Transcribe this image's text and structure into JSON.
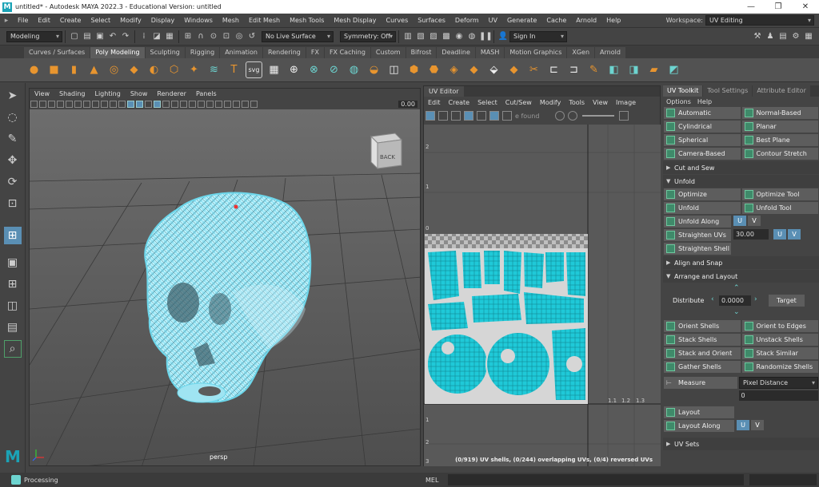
{
  "window": {
    "title": "untitled* - Autodesk MAYA 2022.3 - Educational Version: untitled",
    "minimize": "—",
    "maximize": "❐",
    "close": "✕"
  },
  "menu": [
    "File",
    "Edit",
    "Create",
    "Select",
    "Modify",
    "Display",
    "Windows",
    "Mesh",
    "Edit Mesh",
    "Mesh Tools",
    "Mesh Display",
    "Curves",
    "Surfaces",
    "Deform",
    "UV",
    "Generate",
    "Cache",
    "Arnold",
    "Help"
  ],
  "workspace": {
    "label": "Workspace:",
    "value": "UV Editing"
  },
  "statusline": {
    "mode": "Modeling",
    "live_surface": "No Live Surface",
    "symmetry": "Symmetry: Off",
    "sign_in": "Sign In"
  },
  "shelf_tabs": [
    "Curves / Surfaces",
    "Poly Modeling",
    "Sculpting",
    "Rigging",
    "Animation",
    "Rendering",
    "FX",
    "FX Caching",
    "Custom",
    "Bifrost",
    "Deadline",
    "MASH",
    "Motion Graphics",
    "XGen",
    "Arnold"
  ],
  "shelf_active": "Poly Modeling",
  "shelf_svg": "svg",
  "viewport": {
    "menu": [
      "View",
      "Shading",
      "Lighting",
      "Show",
      "Renderer",
      "Panels"
    ],
    "gamma": "0.00",
    "camera": "persp",
    "cube_label": "BACK"
  },
  "uv_editor": {
    "tab": "UV Editor",
    "menu": [
      "Edit",
      "Create",
      "Select",
      "Cut/Sew",
      "Modify",
      "Tools",
      "View",
      "Image"
    ],
    "found_text": "e found",
    "axis_left": [
      "2",
      "1",
      "0",
      "1",
      "2",
      "3"
    ],
    "axis_bottom": [
      "1.1",
      "1.2",
      "1.3"
    ],
    "status": "(0/919) UV shells, (0/244) overlapping UVs, (0/4) reversed UVs"
  },
  "toolkit": {
    "tabs": [
      "UV Toolkit",
      "Tool Settings",
      "Attribute Editor"
    ],
    "menu": [
      "Options",
      "Help"
    ],
    "projections": [
      [
        "Automatic",
        "Normal-Based"
      ],
      [
        "Cylindrical",
        "Planar"
      ],
      [
        "Spherical",
        "Best Plane"
      ],
      [
        "Camera-Based",
        "Contour Stretch"
      ]
    ],
    "cut_sew": "Cut and Sew",
    "unfold": "Unfold",
    "unfold_rows": [
      [
        "Optimize",
        "Optimize Tool"
      ],
      [
        "Unfold",
        "Unfold Tool"
      ]
    ],
    "unfold_along": "Unfold Along",
    "u": "U",
    "v": "V",
    "straighten_uvs": "Straighten UVs",
    "straighten_value": "30.00",
    "straighten_shell": "Straighten Shell",
    "align_snap": "Align and Snap",
    "arrange": "Arrange and Layout",
    "distribute": "Distribute",
    "distribute_value": "0.0000",
    "target": "Target",
    "layout_rows": [
      [
        "Orient Shells",
        "Orient to Edges"
      ],
      [
        "Stack Shells",
        "Unstack Shells"
      ],
      [
        "Stack and Orient",
        "Stack Similar"
      ],
      [
        "Gather Shells",
        "Randomize Shells"
      ]
    ],
    "measure": "Measure",
    "measure_mode": "Pixel Distance",
    "measure_value": "0",
    "layout": "Layout",
    "layout_along": "Layout Along",
    "uv_sets": "UV Sets"
  },
  "bottom": {
    "processing": "Processing",
    "mel": "MEL"
  },
  "colors": {
    "uv_cyan": "#1fc9d8",
    "accent_blue": "#5a8fb4",
    "maya_teal": "#1ba3b6"
  }
}
